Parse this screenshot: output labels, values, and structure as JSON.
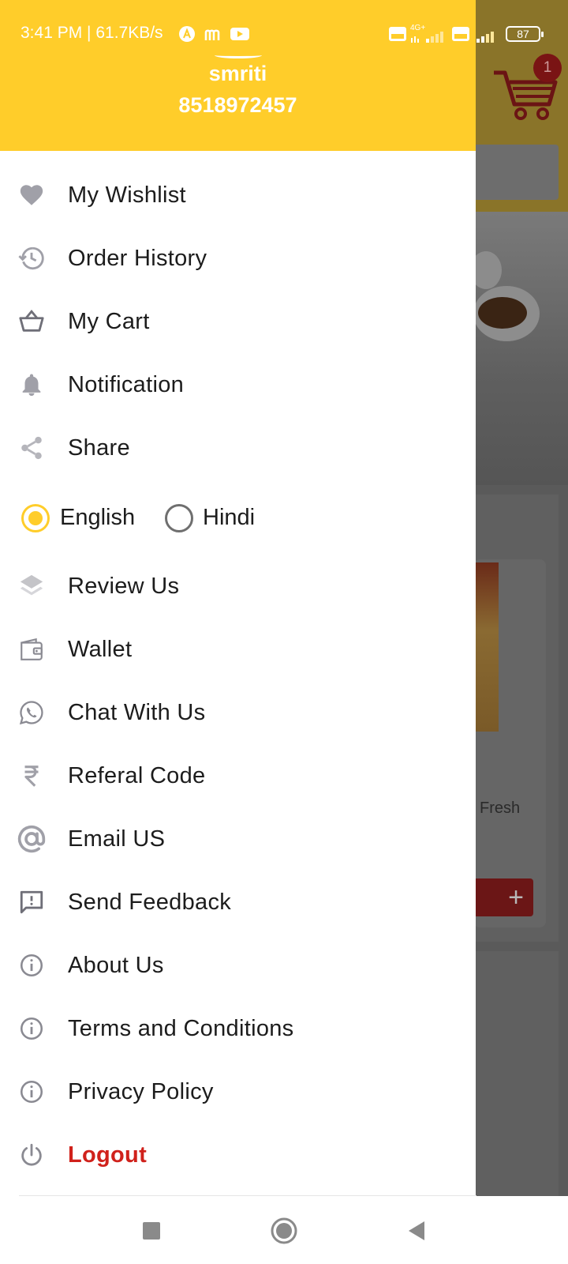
{
  "status_bar": {
    "time": "3:41 PM | 61.7KB/s",
    "network_type": "4G+",
    "volte_label": "Vo LTE",
    "battery": "87"
  },
  "background": {
    "cart_badge": "1",
    "product_name_fragment": "Fresh",
    "add_symbol": "+"
  },
  "drawer": {
    "user_name": "smriti",
    "user_phone": "8518972457",
    "menu_top": [
      {
        "label": "My Wishlist",
        "icon": "heart-icon"
      },
      {
        "label": "Order History",
        "icon": "history-icon"
      },
      {
        "label": "My Cart",
        "icon": "basket-icon"
      },
      {
        "label": "Notification",
        "icon": "bell-icon"
      },
      {
        "label": "Share",
        "icon": "share-icon"
      }
    ],
    "language": {
      "options": [
        "English",
        "Hindi"
      ],
      "selected": "English"
    },
    "menu_bottom": [
      {
        "label": "Review Us",
        "icon": "layers-icon"
      },
      {
        "label": "Wallet",
        "icon": "wallet-icon"
      },
      {
        "label": "Chat With Us",
        "icon": "whatsapp-icon"
      },
      {
        "label": "Referal Code",
        "icon": "rupee-icon"
      },
      {
        "label": "Email US",
        "icon": "at-icon"
      },
      {
        "label": "Send Feedback",
        "icon": "feedback-icon"
      },
      {
        "label": "About Us",
        "icon": "info-icon"
      },
      {
        "label": "Terms and Conditions",
        "icon": "info-icon"
      },
      {
        "label": "Privacy Policy",
        "icon": "info-icon"
      },
      {
        "label": "Logout",
        "icon": "power-icon"
      }
    ]
  },
  "colors": {
    "header_yellow": "#ffcd2a",
    "logout_red": "#d0211b",
    "icon_gray": "#a0a0a8"
  }
}
